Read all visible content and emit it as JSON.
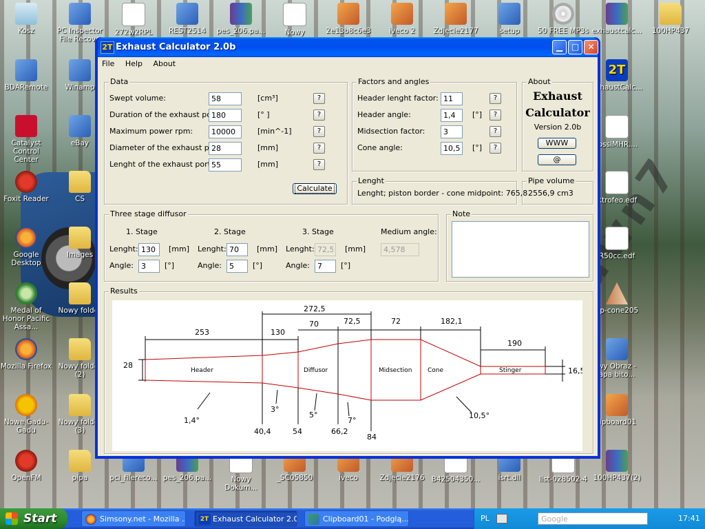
{
  "desktop": {
    "icons": [
      {
        "id": "kosz",
        "label": "Kosz",
        "type": "recyc"
      },
      {
        "id": "pcinspector",
        "label": "PC Inspector File Recove",
        "type": "app"
      },
      {
        "id": "272w",
        "label": "272w2RPL",
        "type": "doc"
      },
      {
        "id": "rest2514",
        "label": "REST2514",
        "type": "app"
      },
      {
        "id": "pes206",
        "label": "pes_206.pa...",
        "type": "rar"
      },
      {
        "id": "nowy",
        "label": "Nowy",
        "type": "doc"
      },
      {
        "id": "2e13",
        "label": "2e13b8c6e3",
        "type": "img"
      },
      {
        "id": "iveco2",
        "label": "iveco 2",
        "type": "img"
      },
      {
        "id": "zdjecie2177",
        "label": "Zdjęcie2177",
        "type": "img"
      },
      {
        "id": "setup",
        "label": "setup",
        "type": "app"
      },
      {
        "id": "mp3s",
        "label": "50 FREE MP3s",
        "type": "cd"
      },
      {
        "id": "exhaustcalc_rar",
        "label": "exhaustcalc...",
        "type": "rar"
      },
      {
        "id": "100hp437",
        "label": "100HP437",
        "type": "folder"
      },
      {
        "id": "bdaremote",
        "label": "BDARemote",
        "type": "app"
      },
      {
        "id": "winamp",
        "label": "Winamp",
        "type": "app"
      },
      {
        "id": "exhaustcalc_2t",
        "label": "exhaustCalc...",
        "type": "t2"
      },
      {
        "id": "ati",
        "label": "Catalyst Control Center",
        "type": "ati"
      },
      {
        "id": "ebay",
        "label": "eBay",
        "type": "app"
      },
      {
        "id": "ossimhr",
        "label": "lossiMHR....",
        "type": "doc"
      },
      {
        "id": "foxit",
        "label": "Foxit Reader",
        "type": "red"
      },
      {
        "id": "cs",
        "label": "CS",
        "type": "folder"
      },
      {
        "id": "rtrofeo",
        "label": "Rtrofeo.edf",
        "type": "doc"
      },
      {
        "id": "googledesktop",
        "label": "Google Desktop",
        "type": "ff"
      },
      {
        "id": "images",
        "label": "Images",
        "type": "folder"
      },
      {
        "id": "r50cc",
        "label": "R50cc.edf",
        "type": "doc"
      },
      {
        "id": "medal",
        "label": "Medal of Honor Pacific Assa...",
        "type": "bug"
      },
      {
        "id": "nowyfolder1",
        "label": "Nowy folder",
        "type": "folder"
      },
      {
        "id": "upcone",
        "label": "up-cone205",
        "type": "cone"
      },
      {
        "id": "firefox",
        "label": "Mozilla Firefox",
        "type": "ff"
      },
      {
        "id": "nowyfolder2",
        "label": "Nowy folder (2)",
        "type": "folder"
      },
      {
        "id": "nowyobraz",
        "label": "wy Obraz - apa bito...",
        "type": "app"
      },
      {
        "id": "gadugadu",
        "label": "Nowe Gadu-Gadu",
        "type": "sun"
      },
      {
        "id": "nowyfolder3",
        "label": "Nowy folder (3)",
        "type": "folder"
      },
      {
        "id": "clipboard01",
        "label": "lipboard01",
        "type": "img"
      },
      {
        "id": "openfm",
        "label": "OpenFM",
        "type": "red"
      },
      {
        "id": "pipa",
        "label": "pipa",
        "type": "folder"
      },
      {
        "id": "pcifilereco",
        "label": "pci_filereco...",
        "type": "app"
      },
      {
        "id": "pes206b",
        "label": "pes_206.pa...",
        "type": "rar"
      },
      {
        "id": "nowydokum",
        "label": "Nowy Dokum...",
        "type": "doc"
      },
      {
        "id": "sc05850",
        "label": "_SC05850",
        "type": "img"
      },
      {
        "id": "iveco",
        "label": "iveco",
        "type": "img"
      },
      {
        "id": "zdjecie2176",
        "label": "Zdjęcie2176",
        "type": "img"
      },
      {
        "id": "b425",
        "label": "B42504350...",
        "type": "doc"
      },
      {
        "id": "isrtdll",
        "label": "isrt.dll",
        "type": "app"
      },
      {
        "id": "list028502",
        "label": "list-028502-4",
        "type": "doc"
      },
      {
        "id": "100hp437_2",
        "label": "100HP437(2)",
        "type": "rar"
      }
    ],
    "watermark": "spawn7"
  },
  "window": {
    "title": "Exhaust Calculator 2.0b",
    "icon_text": "2T",
    "menu": [
      "File",
      "Help",
      "About"
    ],
    "data": {
      "legend": "Data",
      "fields": [
        {
          "label": "Swept volume:",
          "value": "58",
          "unit": "[cm³]"
        },
        {
          "label": "Duration of the exhaust port:",
          "value": "180",
          "unit": "[° ]"
        },
        {
          "label": "Maximum power rpm:",
          "value": "10000",
          "unit": "[min^-1]"
        },
        {
          "label": "Diameter of the exhaust port:",
          "value": "28",
          "unit": "[mm]"
        },
        {
          "label": "Lenght of the exhaust port:",
          "value": "55",
          "unit": "[mm]"
        }
      ],
      "help_label": "?",
      "calculate_label": "Calculate"
    },
    "factors": {
      "legend": "Factors and angles",
      "fields": [
        {
          "label": "Header lenght factor:",
          "value": "11",
          "unit": ""
        },
        {
          "label": "Header angle:",
          "value": "1,4",
          "unit": "[°]"
        },
        {
          "label": "Midsection factor:",
          "value": "3",
          "unit": ""
        },
        {
          "label": "Cone angle:",
          "value": "10,5",
          "unit": "[°]"
        }
      ]
    },
    "about": {
      "legend": "About",
      "title_line1": "Exhaust",
      "title_line2": "Calculator",
      "version": "Version 2.0b",
      "www_label": "WWW",
      "at_label": "@"
    },
    "lenght": {
      "legend": "Lenght",
      "text": "Lenght; piston border - cone midpoint:  765,8"
    },
    "pipe_volume": {
      "legend": "Pipe volume",
      "text": "2556,9 cm3"
    },
    "diffusor": {
      "legend": "Three stage diffusor",
      "stages": [
        {
          "title": "1. Stage",
          "length": "130",
          "angle": "3",
          "disabled": false
        },
        {
          "title": "2. Stage",
          "length": "70",
          "angle": "5",
          "disabled": false
        },
        {
          "title": "3. Stage",
          "length": "72,5",
          "angle": "7",
          "disabled": true
        }
      ],
      "length_label": "Lenght:",
      "angle_label": "Angle:",
      "mm_unit": "[mm]",
      "deg_unit": "[°]",
      "medium_angle_label": "Medium angle:",
      "medium_angle_value": "4,578"
    },
    "note": {
      "legend": "Note",
      "text": ""
    },
    "results": {
      "legend": "Results",
      "sections": [
        "Header",
        "Diffusor",
        "Midsection",
        "Cone",
        "Stinger"
      ],
      "top_dims": [
        "253",
        "130",
        "70",
        "72,5",
        "72",
        "182,1",
        "272,5",
        "190"
      ],
      "left_dim": "28",
      "right_dim": "16,5",
      "bottom_dims": [
        "40,4",
        "54",
        "66,2",
        "84"
      ],
      "angles": [
        "1,4°",
        "3°",
        "5°",
        "7°",
        "10,5°"
      ]
    }
  },
  "taskbar": {
    "start_label": "Start",
    "tasks": [
      {
        "label": "Simsony.net - Mozilla ...",
        "active": false
      },
      {
        "label": "Exhaust Calculator 2.0b",
        "active": true
      },
      {
        "label": "Clipboard01 - Podglą...",
        "active": false
      }
    ],
    "language": "PL",
    "search_placeholder": "Google",
    "clock": "17:41"
  }
}
